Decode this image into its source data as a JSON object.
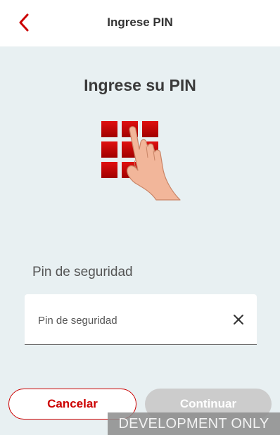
{
  "header": {
    "title": "Ingrese PIN",
    "back_icon": "chevron-left-icon"
  },
  "main": {
    "title": "Ingrese su PIN",
    "illustration": "keypad-hand-illustration",
    "field_label": "Pin de seguridad",
    "pin_input": {
      "placeholder": "Pin de seguridad",
      "value": ""
    },
    "clear_icon": "close-icon"
  },
  "actions": {
    "cancel_label": "Cancelar",
    "continue_label": "Continuar"
  },
  "banner": {
    "text": "DEVELOPMENT ONLY"
  },
  "colors": {
    "accent": "#cc0000",
    "background": "#e8f0f2",
    "disabled": "#cccccc"
  }
}
